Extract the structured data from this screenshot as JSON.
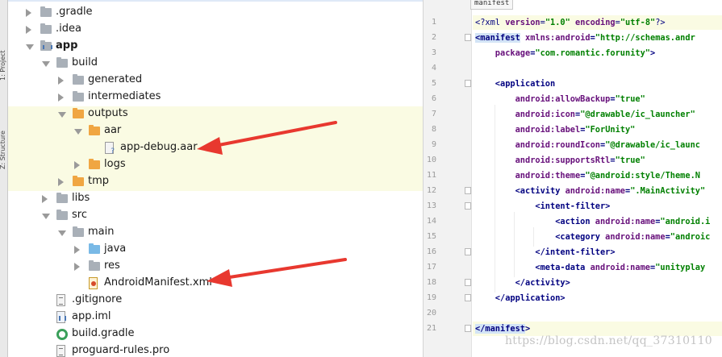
{
  "tool_strip": {
    "project_tab": "1: Project",
    "structure_tab": "Z: Structure"
  },
  "tree": {
    "rows": [
      {
        "label": ".gradle",
        "arrow": "right",
        "icon": "folder-gray",
        "bold": false
      },
      {
        "label": ".idea",
        "arrow": "right",
        "icon": "folder-gray",
        "bold": false
      },
      {
        "label": "app",
        "arrow": "down",
        "icon": "folder-module",
        "bold": true
      },
      {
        "label": "build",
        "arrow": "down",
        "icon": "folder-gray",
        "bold": false
      },
      {
        "label": "generated",
        "arrow": "right",
        "icon": "folder-gray",
        "bold": false
      },
      {
        "label": "intermediates",
        "arrow": "right",
        "icon": "folder-gray",
        "bold": false
      },
      {
        "label": "outputs",
        "arrow": "down",
        "icon": "folder-orange",
        "bold": false
      },
      {
        "label": "aar",
        "arrow": "down",
        "icon": "folder-orange",
        "bold": false
      },
      {
        "label": "app-debug.aar",
        "arrow": "none",
        "icon": "file-aar",
        "bold": false
      },
      {
        "label": "logs",
        "arrow": "right",
        "icon": "folder-orange",
        "bold": false
      },
      {
        "label": "tmp",
        "arrow": "right",
        "icon": "folder-orange",
        "bold": false
      },
      {
        "label": "libs",
        "arrow": "right",
        "icon": "folder-gray",
        "bold": false
      },
      {
        "label": "src",
        "arrow": "down",
        "icon": "folder-gray",
        "bold": false
      },
      {
        "label": "main",
        "arrow": "down",
        "icon": "folder-gray",
        "bold": false
      },
      {
        "label": "java",
        "arrow": "right",
        "icon": "folder-blue",
        "bold": false
      },
      {
        "label": "res",
        "arrow": "right",
        "icon": "folder-gray",
        "bold": false
      },
      {
        "label": "AndroidManifest.xml",
        "arrow": "none",
        "icon": "file-xml",
        "bold": false
      },
      {
        "label": ".gitignore",
        "arrow": "none",
        "icon": "file-txt",
        "bold": false
      },
      {
        "label": "app.iml",
        "arrow": "none",
        "icon": "file-iml",
        "bold": false
      },
      {
        "label": "build.gradle",
        "arrow": "none",
        "icon": "gradle",
        "bold": false
      },
      {
        "label": "proguard-rules.pro",
        "arrow": "none",
        "icon": "file-txt",
        "bold": false
      }
    ]
  },
  "editor": {
    "breadcrumb_tag": "manifest",
    "line_numbers": [
      "1",
      "2",
      "3",
      "4",
      "5",
      "6",
      "7",
      "8",
      "9",
      "10",
      "11",
      "12",
      "13",
      "14",
      "15",
      "16",
      "17",
      "18",
      "19",
      "20",
      "21"
    ],
    "lines": [
      [
        {
          "t": "xmldecl",
          "s": "<?xml "
        },
        {
          "t": "attr",
          "s": "version"
        },
        {
          "t": "xmldecl",
          "s": "="
        },
        {
          "t": "val",
          "s": "\"1.0\""
        },
        {
          "t": "xmldecl",
          "s": " "
        },
        {
          "t": "attr",
          "s": "encoding"
        },
        {
          "t": "xmldecl",
          "s": "="
        },
        {
          "t": "val",
          "s": "\"utf-8\""
        },
        {
          "t": "xmldecl",
          "s": "?>"
        }
      ],
      [
        {
          "t": "taghl",
          "s": "<manifest"
        },
        {
          "t": "attr",
          "s": " xmlns:android"
        },
        {
          "t": "tag",
          "s": "="
        },
        {
          "t": "val",
          "s": "\"http://schemas.andr"
        }
      ],
      [
        {
          "t": "attr",
          "s": "    package"
        },
        {
          "t": "tag",
          "s": "="
        },
        {
          "t": "val",
          "s": "\"com.romantic.forunity\""
        },
        {
          "t": "tag",
          "s": ">"
        }
      ],
      [],
      [
        {
          "t": "tag",
          "s": "    <application"
        }
      ],
      [
        {
          "t": "attr",
          "s": "        android:allowBackup"
        },
        {
          "t": "tag",
          "s": "="
        },
        {
          "t": "val",
          "s": "\"true\""
        }
      ],
      [
        {
          "t": "attr",
          "s": "        android:icon"
        },
        {
          "t": "tag",
          "s": "="
        },
        {
          "t": "val",
          "s": "\"@drawable/ic_launcher\""
        }
      ],
      [
        {
          "t": "attr",
          "s": "        android:label"
        },
        {
          "t": "tag",
          "s": "="
        },
        {
          "t": "val",
          "s": "\"ForUnity\""
        }
      ],
      [
        {
          "t": "attr",
          "s": "        android:roundIcon"
        },
        {
          "t": "tag",
          "s": "="
        },
        {
          "t": "val",
          "s": "\"@drawable/ic_launc"
        }
      ],
      [
        {
          "t": "attr",
          "s": "        android:supportsRtl"
        },
        {
          "t": "tag",
          "s": "="
        },
        {
          "t": "val",
          "s": "\"true\""
        }
      ],
      [
        {
          "t": "attr",
          "s": "        android:theme"
        },
        {
          "t": "tag",
          "s": "="
        },
        {
          "t": "val",
          "s": "\"@android:style/Theme.N"
        }
      ],
      [
        {
          "t": "tag",
          "s": "        <activity"
        },
        {
          "t": "attr",
          "s": " android:name"
        },
        {
          "t": "tag",
          "s": "="
        },
        {
          "t": "val",
          "s": "\".MainActivity\""
        }
      ],
      [
        {
          "t": "tag",
          "s": "            <intent-filter>"
        }
      ],
      [
        {
          "t": "tag",
          "s": "                <action"
        },
        {
          "t": "attr",
          "s": " android:name"
        },
        {
          "t": "tag",
          "s": "="
        },
        {
          "t": "val",
          "s": "\"android.i"
        }
      ],
      [
        {
          "t": "tag",
          "s": "                <category"
        },
        {
          "t": "attr",
          "s": " android:name"
        },
        {
          "t": "tag",
          "s": "="
        },
        {
          "t": "val",
          "s": "\"androic"
        }
      ],
      [
        {
          "t": "tag",
          "s": "            </intent-filter>"
        }
      ],
      [
        {
          "t": "tag",
          "s": "            <meta-data"
        },
        {
          "t": "attr",
          "s": " android:name"
        },
        {
          "t": "tag",
          "s": "="
        },
        {
          "t": "val",
          "s": "\"unityplay"
        }
      ],
      [
        {
          "t": "tag",
          "s": "        </activity>"
        }
      ],
      [
        {
          "t": "tag",
          "s": "    </application>"
        }
      ],
      [],
      [
        {
          "t": "taghl",
          "s": "</manifest"
        },
        {
          "t": "tag",
          "s": ">"
        }
      ]
    ]
  },
  "watermark": "https://blog.csdn.net/qq_37310110",
  "colors": {
    "row_highlight": "#fafbe3",
    "annotation_arrow": "#e8382f",
    "xml_tag": "#000080",
    "xml_attr": "#660e7a",
    "xml_value": "#008000"
  }
}
